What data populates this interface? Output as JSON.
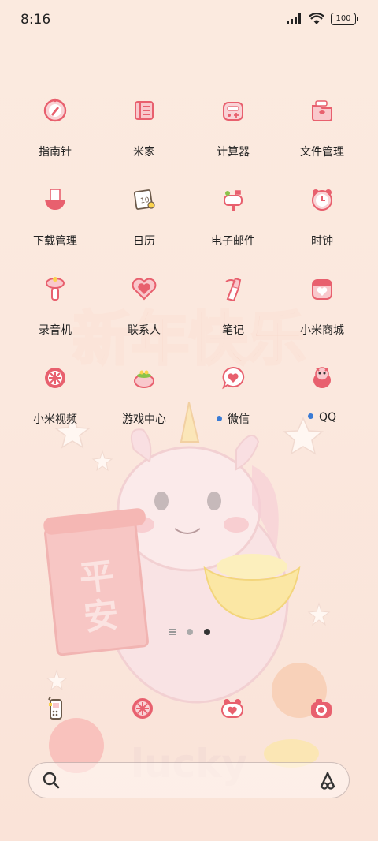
{
  "status_bar": {
    "time": "8:16",
    "battery": "100"
  },
  "apps": [
    {
      "id": "compass",
      "label": "指南针",
      "icon": "compass-icon"
    },
    {
      "id": "mijia",
      "label": "米家",
      "icon": "mijia-icon"
    },
    {
      "id": "calculator",
      "label": "计算器",
      "icon": "calculator-icon"
    },
    {
      "id": "files",
      "label": "文件管理",
      "icon": "folder-icon"
    },
    {
      "id": "downloads",
      "label": "下载管理",
      "icon": "download-icon"
    },
    {
      "id": "calendar",
      "label": "日历",
      "icon": "calendar-icon"
    },
    {
      "id": "email",
      "label": "电子邮件",
      "icon": "mailbox-icon"
    },
    {
      "id": "clock",
      "label": "时钟",
      "icon": "clock-icon"
    },
    {
      "id": "recorder",
      "label": "录音机",
      "icon": "microphone-icon"
    },
    {
      "id": "contacts",
      "label": "联系人",
      "icon": "contacts-icon"
    },
    {
      "id": "notes",
      "label": "笔记",
      "icon": "notes-icon"
    },
    {
      "id": "mistore",
      "label": "小米商城",
      "icon": "store-icon"
    },
    {
      "id": "mivideo",
      "label": "小米视频",
      "icon": "video-icon"
    },
    {
      "id": "gamecenter",
      "label": "游戏中心",
      "icon": "game-icon"
    },
    {
      "id": "wechat",
      "label": "微信",
      "icon": "wechat-icon",
      "new_dot": true
    },
    {
      "id": "qq",
      "label": "QQ",
      "icon": "qq-icon",
      "new_dot": true
    }
  ],
  "wallpaper_text": {
    "banner": "新年快乐",
    "scroll": "平安",
    "word": "lucky"
  },
  "pager": {
    "pages": 2,
    "active": 2
  },
  "dock": [
    {
      "id": "phone",
      "icon": "phone-icon"
    },
    {
      "id": "browser",
      "icon": "browser-icon"
    },
    {
      "id": "messages",
      "icon": "messages-icon"
    },
    {
      "id": "camera",
      "icon": "camera-icon"
    }
  ],
  "search": {
    "placeholder": ""
  },
  "colors": {
    "accent": "#e8606e",
    "dot": "#3a7bd5",
    "background": "#fbeadf"
  }
}
